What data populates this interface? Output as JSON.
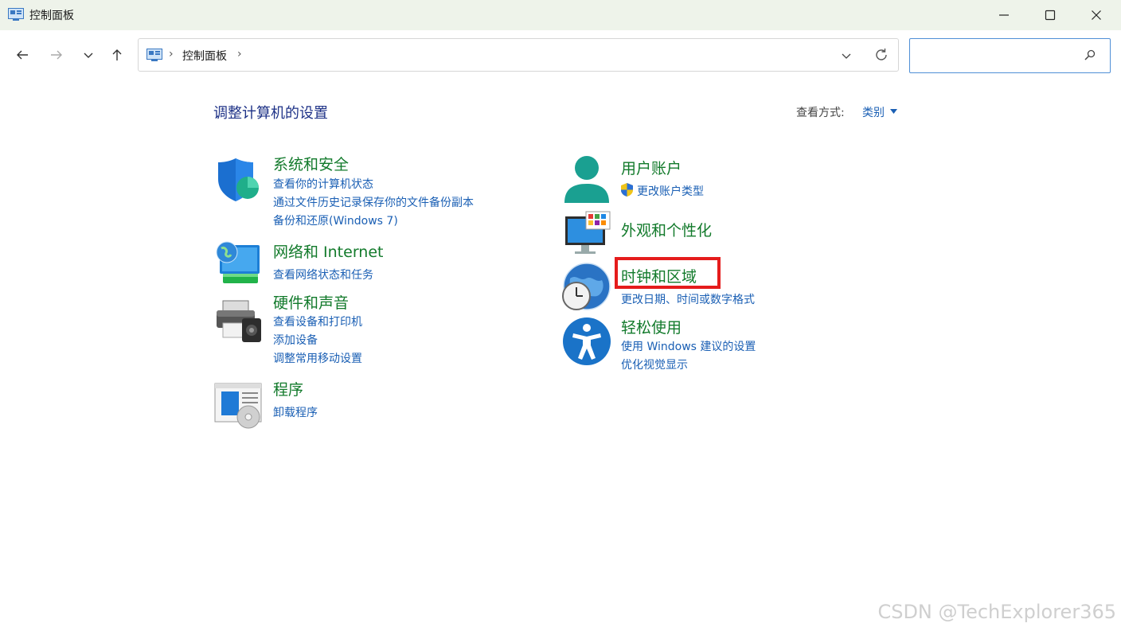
{
  "window": {
    "title": "控制面板"
  },
  "address": {
    "crumb": "控制面板",
    "separator": "›"
  },
  "search": {
    "value": "",
    "placeholder": ""
  },
  "page": {
    "title": "调整计算机的设置",
    "view_by_label": "查看方式:",
    "view_by_value": "类别"
  },
  "categories": {
    "system_security": {
      "title": "系统和安全",
      "links": [
        "查看你的计算机状态",
        "通过文件历史记录保存你的文件备份副本",
        "备份和还原(Windows 7)"
      ]
    },
    "network": {
      "title": "网络和 Internet",
      "links": [
        "查看网络状态和任务"
      ]
    },
    "hardware": {
      "title": "硬件和声音",
      "links": [
        "查看设备和打印机",
        "添加设备",
        "调整常用移动设置"
      ]
    },
    "programs": {
      "title": "程序",
      "links": [
        "卸载程序"
      ]
    },
    "user_accounts": {
      "title": "用户账户",
      "links": [
        "更改账户类型"
      ]
    },
    "appearance": {
      "title": "外观和个性化",
      "links": []
    },
    "clock_region": {
      "title": "时钟和区域",
      "links": [
        "更改日期、时间或数字格式"
      ]
    },
    "ease_of_access": {
      "title": "轻松使用",
      "links": [
        "使用 Windows 建议的设置",
        "优化视觉显示"
      ]
    }
  },
  "watermark": "CSDN @TechExplorer365",
  "colors": {
    "title_bar": "#eef3ea",
    "category_green": "#127a2b",
    "link_blue": "#1a5fb4",
    "heading_blue": "#1e3287",
    "highlight_red": "#e51c1c",
    "search_border": "#4f8fd6"
  }
}
